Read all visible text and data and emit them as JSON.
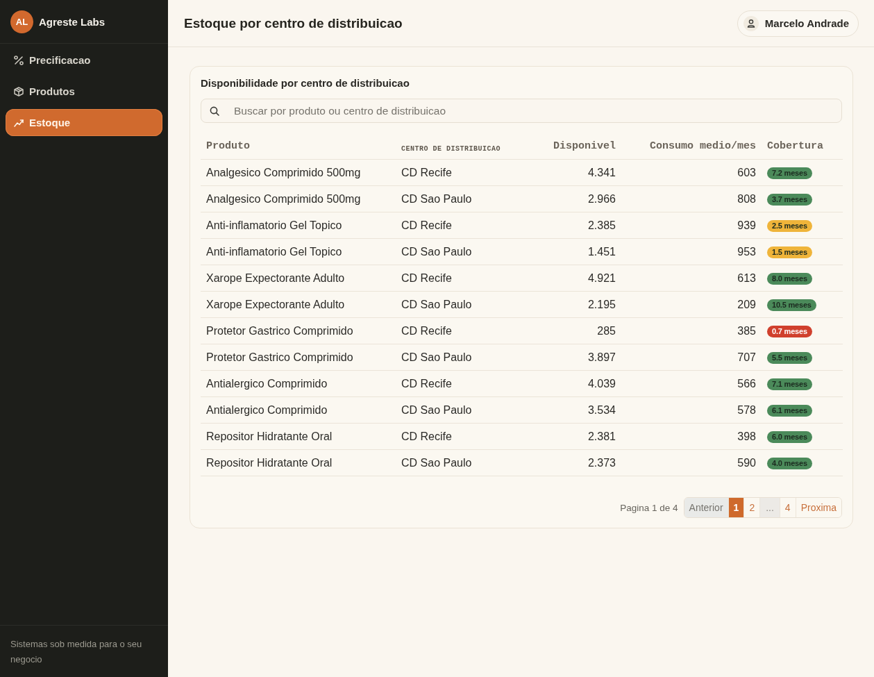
{
  "sidebar": {
    "brand": {
      "initials": "AL",
      "name": "Agreste Labs"
    },
    "items": [
      {
        "label": "Precificacao",
        "selected": false
      },
      {
        "label": "Produtos",
        "selected": false
      },
      {
        "label": "Estoque",
        "selected": true
      }
    ],
    "footer": "Sistemas sob medida para o seu negocio"
  },
  "header": {
    "title": "Estoque por centro de distribuicao",
    "user": "Marcelo Andrade"
  },
  "card": {
    "title": "Disponibilidade por centro de distribuicao",
    "search": {
      "placeholder": "Buscar por produto ou centro de distribuicao"
    },
    "table": {
      "columns": [
        "Produto",
        "CENTRO DE DISTRIBUICAO",
        "Disponivel",
        "Consumo medio/mes",
        "Cobertura"
      ],
      "rows": [
        {
          "produto": "Analgesico Comprimido 500mg",
          "centro": "CD Recife",
          "disponivel": "4.341",
          "consumo": "603",
          "cobertura": "7.2 meses",
          "color": "#4b8a5a"
        },
        {
          "produto": "Analgesico Comprimido 500mg",
          "centro": "CD Sao Paulo",
          "disponivel": "2.966",
          "consumo": "808",
          "cobertura": "3.7 meses",
          "color": "#4b8a5a"
        },
        {
          "produto": "Anti-inflamatorio Gel Topico",
          "centro": "CD Recife",
          "disponivel": "2.385",
          "consumo": "939",
          "cobertura": "2.5 meses",
          "color": "#efb43a"
        },
        {
          "produto": "Anti-inflamatorio Gel Topico",
          "centro": "CD Sao Paulo",
          "disponivel": "1.451",
          "consumo": "953",
          "cobertura": "1.5 meses",
          "color": "#efb43a"
        },
        {
          "produto": "Xarope Expectorante Adulto",
          "centro": "CD Recife",
          "disponivel": "4.921",
          "consumo": "613",
          "cobertura": "8.0 meses",
          "color": "#4b8a5a"
        },
        {
          "produto": "Xarope Expectorante Adulto",
          "centro": "CD Sao Paulo",
          "disponivel": "2.195",
          "consumo": "209",
          "cobertura": "10.5 meses",
          "color": "#4b8a5a"
        },
        {
          "produto": "Protetor Gastrico Comprimido",
          "centro": "CD Recife",
          "disponivel": "285",
          "consumo": "385",
          "cobertura": "0.7 meses",
          "color": "#d0402d"
        },
        {
          "produto": "Protetor Gastrico Comprimido",
          "centro": "CD Sao Paulo",
          "disponivel": "3.897",
          "consumo": "707",
          "cobertura": "5.5 meses",
          "color": "#4b8a5a"
        },
        {
          "produto": "Antialergico Comprimido",
          "centro": "CD Recife",
          "disponivel": "4.039",
          "consumo": "566",
          "cobertura": "7.1 meses",
          "color": "#4b8a5a"
        },
        {
          "produto": "Antialergico Comprimido",
          "centro": "CD Sao Paulo",
          "disponivel": "3.534",
          "consumo": "578",
          "cobertura": "6.1 meses",
          "color": "#4b8a5a"
        },
        {
          "produto": "Repositor Hidratante Oral",
          "centro": "CD Recife",
          "disponivel": "2.381",
          "consumo": "398",
          "cobertura": "6.0 meses",
          "color": "#4b8a5a"
        },
        {
          "produto": "Repositor Hidratante Oral",
          "centro": "CD Sao Paulo",
          "disponivel": "2.373",
          "consumo": "590",
          "cobertura": "4.0 meses",
          "color": "#4b8a5a"
        }
      ]
    },
    "pagination": {
      "summary": "Pagina 1 de 4",
      "previous": {
        "label": "Anterior",
        "disabled": true
      },
      "pages": [
        {
          "kind": "page",
          "label": "1",
          "selected": true
        },
        {
          "kind": "page",
          "label": "2",
          "selected": false
        },
        {
          "kind": "ellipsis",
          "label": "..."
        },
        {
          "kind": "page",
          "label": "4",
          "selected": false
        }
      ],
      "next": {
        "label": "Proxima",
        "disabled": false
      }
    }
  }
}
